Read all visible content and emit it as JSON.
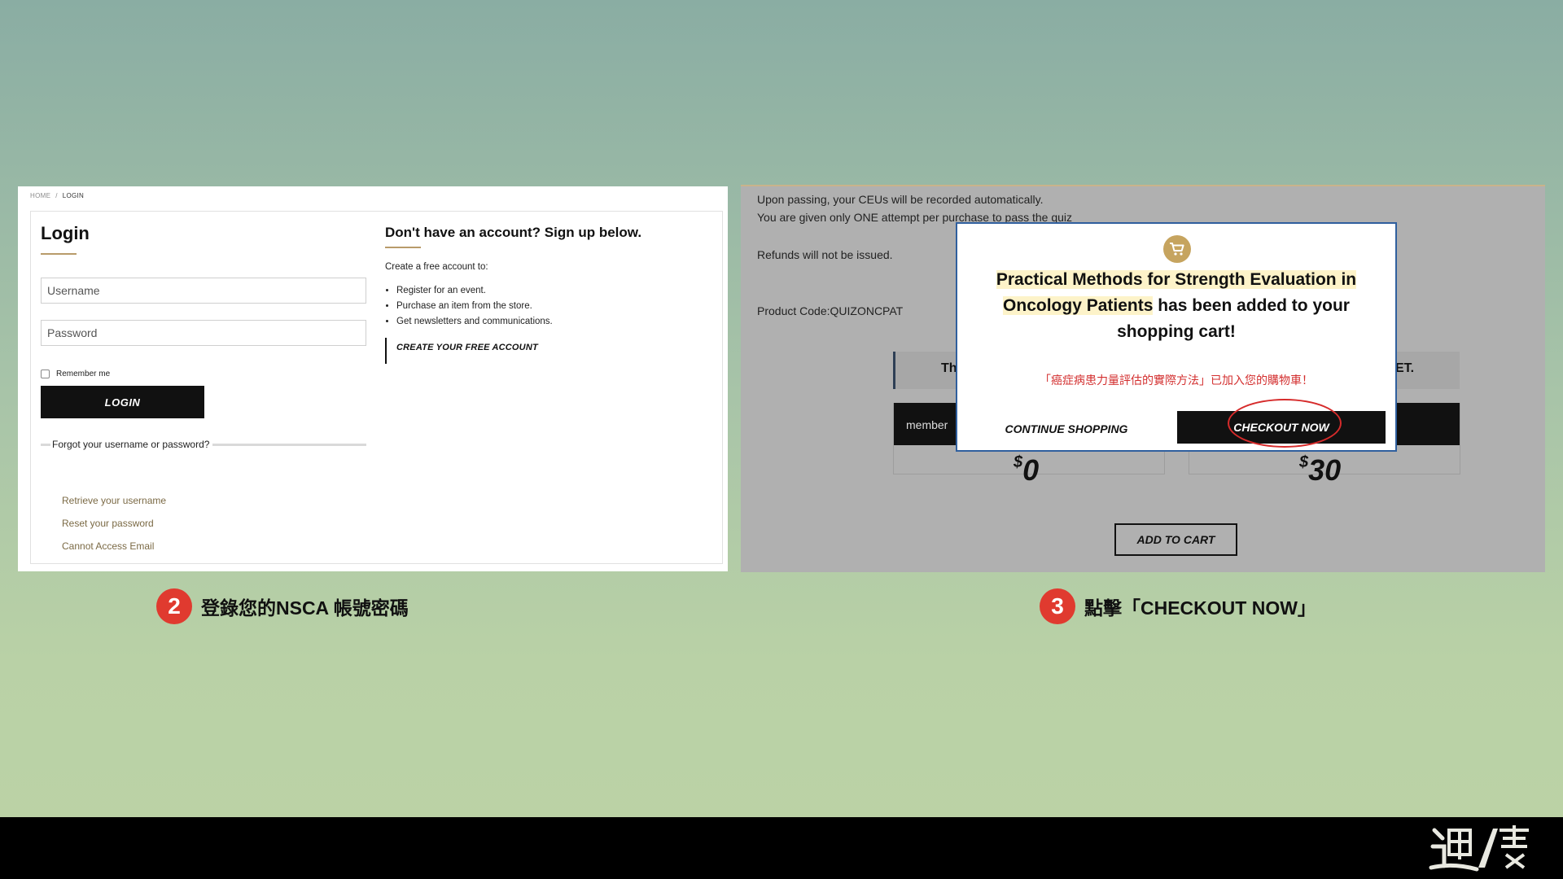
{
  "login_page": {
    "breadcrumb": {
      "home": "HOME",
      "separator": "/",
      "current": "LOGIN"
    },
    "title": "Login",
    "username_placeholder": "Username",
    "password_placeholder": "Password",
    "remember_label": "Remember me",
    "login_button": "LOGIN",
    "forgot_heading": "Forgot your username or password?",
    "links": [
      "Retrieve your username",
      "Reset your password",
      "Cannot Access Email"
    ],
    "signup": {
      "title": "Don't have an account? Sign up below.",
      "intro": "Create a free account to:",
      "benefits": [
        "Register for an event.",
        "Purchase an item from the store.",
        "Get newsletters and communications."
      ],
      "create_link": "CREATE YOUR FREE ACCOUNT"
    }
  },
  "product_page": {
    "info_lines": [
      "Upon passing, your CEUs will be recorded automatically.",
      "You are given only ONE attempt per purchase to pass the quiz",
      "Refunds will not be issued.",
      "Product Code:QUIZONCPAT"
    ],
    "tab_left_fragment": "Th",
    "tab_right_fragment": "ET.",
    "member_label": "member",
    "prices": [
      {
        "currency": "$",
        "amount": "0"
      },
      {
        "currency": "$",
        "amount": "30"
      }
    ],
    "add_to_cart": "ADD TO CART",
    "modal": {
      "product_name": "Practical Methods for Strength Evaluation in Oncology Patients",
      "added_text": "has been added to your shopping cart!",
      "zh_notice": "「癌症病患力量評估的實際方法」已加入您的購物車！",
      "continue_button": "CONTINUE SHOPPING",
      "checkout_button": "CHECKOUT NOW"
    }
  },
  "captions": [
    {
      "number": "2",
      "text": "登錄您的NSCA 帳號密碼"
    },
    {
      "number": "3",
      "text": "點擊「CHECKOUT NOW」"
    }
  ],
  "colors": {
    "accent_gold": "#b89b6a",
    "highlight_red": "#e03a2f",
    "modal_border": "#2f5f9e"
  }
}
